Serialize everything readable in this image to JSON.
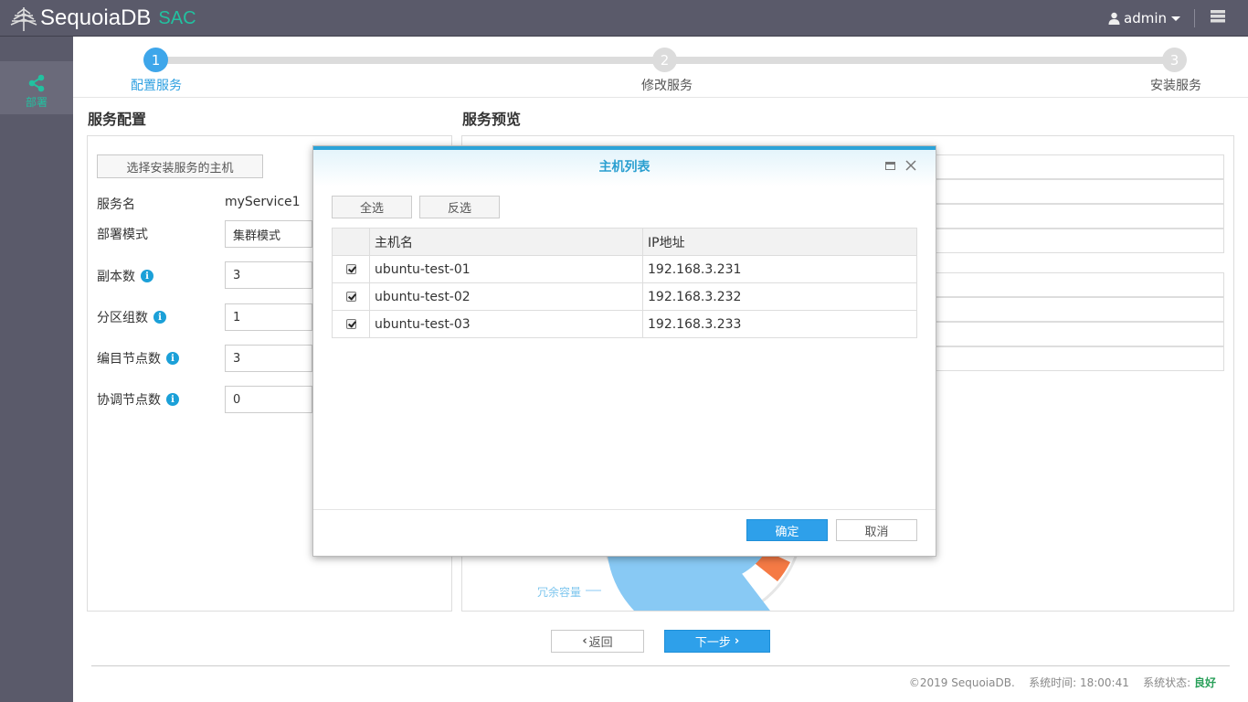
{
  "app": {
    "name": "SequoiaDB",
    "product": "SAC"
  },
  "header": {
    "user": "admin"
  },
  "sidebar": {
    "items": [
      {
        "label": "部署",
        "icon": "share-icon"
      }
    ]
  },
  "steps": [
    {
      "number": "1",
      "label": "配置服务",
      "active": true
    },
    {
      "number": "2",
      "label": "修改服务",
      "active": false
    },
    {
      "number": "3",
      "label": "安装服务",
      "active": false
    }
  ],
  "config": {
    "title": "服务配置",
    "select_hosts_button": "选择安装服务的主机",
    "service_name_label": "服务名",
    "service_name_value": "myService1",
    "deploy_mode_label": "部署模式",
    "deploy_mode_value": "集群模式",
    "replica_label": "副本数",
    "replica_value": "3",
    "partition_label": "分区组数",
    "partition_value": "1",
    "catalog_label": "编目节点数",
    "catalog_value": "3",
    "coord_label": "协调节点数",
    "coord_value": "0"
  },
  "preview": {
    "title": "服务预览",
    "legend_redundant": "冗余容量"
  },
  "dialog": {
    "title": "主机列表",
    "select_all": "全选",
    "invert": "反选",
    "columns": [
      "主机名",
      "IP地址"
    ],
    "rows": [
      {
        "host": "ubuntu-test-01",
        "ip": "192.168.3.231",
        "checked": true
      },
      {
        "host": "ubuntu-test-02",
        "ip": "192.168.3.232",
        "checked": true
      },
      {
        "host": "ubuntu-test-03",
        "ip": "192.168.3.233",
        "checked": true
      }
    ],
    "ok": "确定",
    "cancel": "取消"
  },
  "nav": {
    "back": "返回",
    "next": "下一步"
  },
  "footer": {
    "copyright": "©2019 SequoiaDB.",
    "time_label": "系统时间:",
    "time_value": "18:00:41",
    "status_label": "系统状态:",
    "status_value": "良好"
  },
  "colors": {
    "accent": "#3ea6ea",
    "brand": "#22c1a0",
    "header": "#5a5a6a",
    "status_ok": "#2aa05a"
  }
}
